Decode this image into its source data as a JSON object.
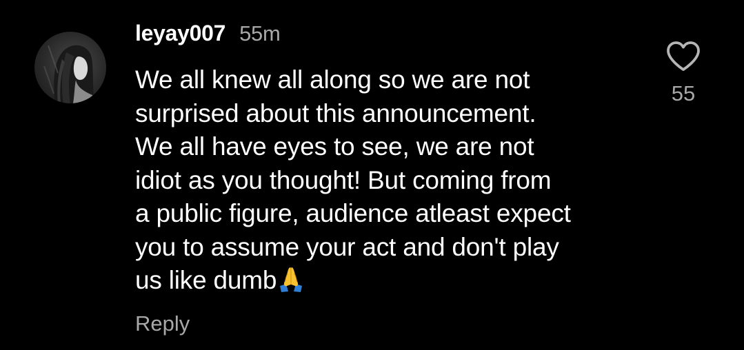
{
  "comment": {
    "username": "leyay007",
    "time": "55m",
    "text_lines": [
      "We all knew all along so we are not",
      "surprised about this announcement.",
      "We all have eyes to see, we are not",
      "idiot as you thought! But coming from",
      "a public figure, audience atleast expect",
      "you to assume your act and don't play",
      "us like dumb"
    ],
    "emoji": "folded-hands",
    "reply_label": "Reply",
    "like_count": "55"
  },
  "icons": {
    "like": "heart-outline-icon",
    "avatar": "profile-photo"
  },
  "colors": {
    "background": "#000000",
    "primary_text": "#ffffff",
    "secondary_text": "#a8a8a8",
    "emoji_yellow": "#f7c12f",
    "emoji_blue": "#2f7fd6"
  }
}
